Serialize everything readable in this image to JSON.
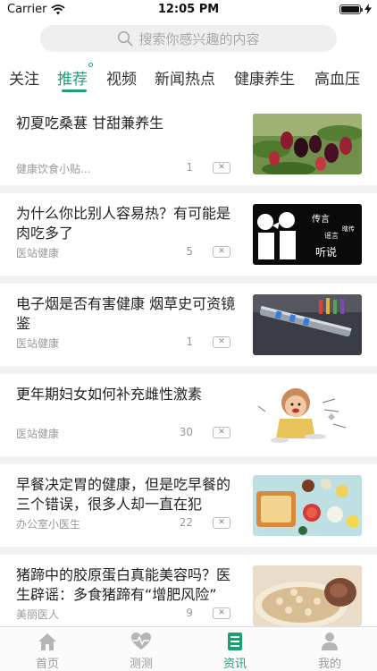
{
  "status_bar": {
    "carrier": "Carrier",
    "time": "12:05 PM"
  },
  "search": {
    "placeholder": "搜索你感兴趣的内容"
  },
  "tabs": [
    {
      "label": "关注",
      "active": false
    },
    {
      "label": "推荐",
      "active": true
    },
    {
      "label": "视频",
      "active": false
    },
    {
      "label": "新闻热点",
      "active": false
    },
    {
      "label": "健康养生",
      "active": false
    },
    {
      "label": "高血压",
      "active": false
    }
  ],
  "articles": [
    {
      "title": "初夏吃桑葚 甘甜兼养生",
      "source": "健康饮食小贴...",
      "count": "1",
      "thumb": "mulberries"
    },
    {
      "title": "为什么你比别人容易热？有可能是肉吃多了",
      "source": "医站健康",
      "count": "5",
      "thumb": "rumor-poster",
      "thumb_text": {
        "a": "传言",
        "b": "谣言",
        "c": "瞎传",
        "d": "听说"
      }
    },
    {
      "title": "电子烟是否有害健康 烟草史可资镜鉴",
      "source": "医站健康",
      "count": "1",
      "thumb": "e-cigarette"
    },
    {
      "title": "更年期妇女如何补充雌性激素",
      "source": "医站健康",
      "count": "30",
      "thumb": "cartoon-woman"
    },
    {
      "title": "早餐决定胃的健康，但是吃早餐的三个错误，很多人却一直在犯",
      "source": "办公室小医生",
      "count": "22",
      "thumb": "breakfast"
    },
    {
      "title": "猪蹄中的胶原蛋白真能美容吗？医生辟谣：多食猪蹄有“增肥风险”",
      "source": "美丽医人",
      "count": "9",
      "thumb": "pork-trotter-soup"
    }
  ],
  "tabbar": [
    {
      "label": "首页",
      "icon": "home-icon",
      "active": false
    },
    {
      "label": "测测",
      "icon": "heartbeat-icon",
      "active": false
    },
    {
      "label": "资讯",
      "icon": "news-icon",
      "active": true
    },
    {
      "label": "我的",
      "icon": "profile-icon",
      "active": false
    }
  ],
  "colors": {
    "accent": "#1aa16f",
    "muted": "#999999",
    "separator": "#f2f2f2"
  }
}
